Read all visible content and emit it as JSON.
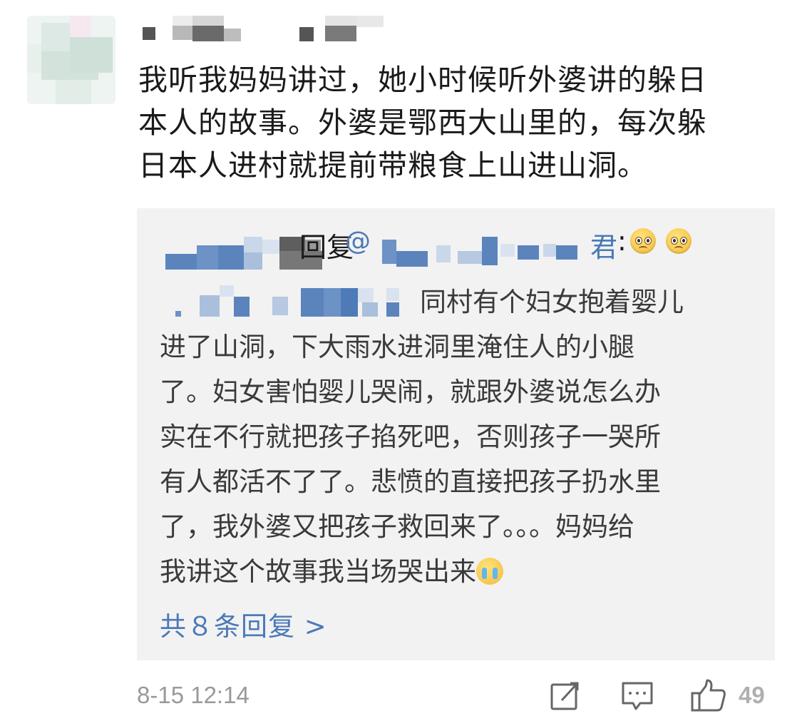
{
  "comment": {
    "text_lines": [
      "我听我妈妈讲过，她小时候听外婆讲的躲日",
      "本人的故事。外婆是鄂西大山里的，每次躲",
      "日本人进村就提前带粮食上山进山洞。"
    ]
  },
  "reply": {
    "prefix": "回复",
    "at": "@",
    "name_tail": "君",
    "colon": ":",
    "emoji_names": [
      "pleading-face-icon",
      "pleading-face-icon"
    ],
    "body_lines": [
      "同村有个妇女抱着婴儿",
      "进了山洞，下大雨水进洞里淹住人的小腿",
      "了。妇女害怕婴儿哭闹，就跟外婆说怎么办",
      "实在不行就把孩子掐死吧，否则孩子一哭所",
      "有人都活不了了。悲愤的直接把孩子扔水里",
      "了，我外婆又把孩子救回来了。。。妈妈给",
      "我讲这个故事我当场哭出来"
    ],
    "end_emoji": "loudly-crying-face-icon",
    "more_link": "共８条回复 >"
  },
  "footer": {
    "timestamp": "8-15 12:14",
    "like_count": "49",
    "icons": [
      "share-icon",
      "comment-icon",
      "like-icon"
    ]
  },
  "colors": {
    "link": "#4a79b8",
    "reply_background": "#f2f2f2",
    "muted": "#999999"
  }
}
